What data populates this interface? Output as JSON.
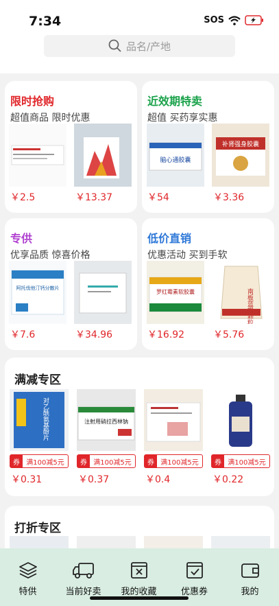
{
  "status": {
    "time": "7:34",
    "sos": "SOS"
  },
  "search": {
    "placeholder": "品名/产地"
  },
  "promo_cards": [
    {
      "title": "限时抢购",
      "title_color": "#e0262a",
      "subtitle": "超值商品 限时优惠",
      "products": [
        {
          "price": "￥2.5",
          "icon": "medicine-box"
        },
        {
          "price": "￥13.37",
          "icon": "medicine-box"
        }
      ]
    },
    {
      "title": "近效期特卖",
      "title_color": "#1aa24a",
      "subtitle": "超值 买药享实惠",
      "products": [
        {
          "price": "￥54",
          "icon": "medicine-box",
          "box_text": "脑心通胶囊"
        },
        {
          "price": "￥3.36",
          "icon": "medicine-box",
          "box_text": "补肾强身胶囊"
        }
      ]
    },
    {
      "title": "专供",
      "title_color": "#b040d0",
      "subtitle": "优享品质 惊喜价格",
      "products": [
        {
          "price": "￥7.6",
          "icon": "medicine-box",
          "box_text": "阿托伐他汀钙分散片"
        },
        {
          "price": "￥34.96",
          "icon": "medicine-box"
        }
      ]
    },
    {
      "title": "低价直销",
      "title_color": "#2e78d8",
      "subtitle": "优惠活动 买到手软",
      "products": [
        {
          "price": "￥16.92",
          "icon": "medicine-box",
          "box_text": "罗红霉素软胶囊"
        },
        {
          "price": "￥5.76",
          "icon": "medicine-bag",
          "box_text": "南板蓝根颗粒"
        }
      ]
    }
  ],
  "discount_section": {
    "title": "满减专区",
    "products": [
      {
        "price": "￥0.31",
        "coupon": "券",
        "coupon_text": "满100减5元",
        "icon": "medicine-box",
        "box_text": "对乙酰氨基酚片"
      },
      {
        "price": "￥0.37",
        "coupon": "券",
        "coupon_text": "满100减5元",
        "icon": "medicine-box",
        "box_text": "注射用硝拉西林钠"
      },
      {
        "price": "￥0.4",
        "coupon": "券",
        "coupon_text": "满100减5元",
        "icon": "medicine-box"
      },
      {
        "price": "￥0.22",
        "coupon": "券",
        "coupon_text": "满100减5元",
        "icon": "medicine-bottle"
      }
    ]
  },
  "sale_section": {
    "title": "打折专区"
  },
  "tabbar": {
    "items": [
      {
        "label": "特供",
        "icon": "layers-icon"
      },
      {
        "label": "当前好卖",
        "icon": "truck-icon"
      },
      {
        "label": "我的收藏",
        "icon": "box-x-icon"
      },
      {
        "label": "优惠券",
        "icon": "box-check-icon"
      },
      {
        "label": "我的",
        "icon": "wallet-icon"
      }
    ]
  },
  "colors": {
    "price": "#e0262a",
    "tabbar_bg": "#d9ede2",
    "page_bg": "#f2f2f2"
  }
}
